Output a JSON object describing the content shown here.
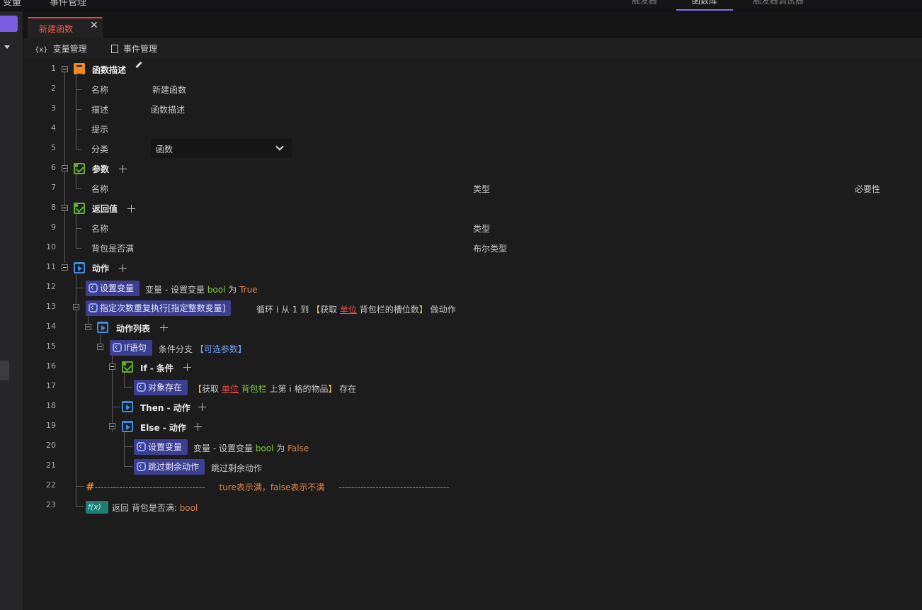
{
  "window": {
    "top_menu": {
      "variables": "变量",
      "events": "事件管理",
      "tabs": [
        "触发器",
        "函数库",
        "触发器调试器"
      ]
    }
  },
  "doc_tab": {
    "label": "新建函数",
    "close": "✕"
  },
  "toolbar": {
    "variables_label": "变量管理",
    "events_label": "事件管理",
    "variables_icon": "{x}"
  },
  "lines": [
    "1",
    "2",
    "3",
    "4",
    "5",
    "6",
    "7",
    "8",
    "9",
    "10",
    "11",
    "12",
    "13",
    "14",
    "15",
    "16",
    "17",
    "18",
    "19",
    "20",
    "21",
    "22",
    "23"
  ],
  "func_desc": {
    "title": "函数描述",
    "name_label": "名称",
    "name_value": "新建函数",
    "desc_label": "描述",
    "desc_value": "函数描述",
    "hint_label": "提示",
    "category_label": "分类",
    "category_value": "函数"
  },
  "params": {
    "title": "参数",
    "col_name": "名称",
    "col_type": "类型",
    "col_required": "必要性"
  },
  "returns": {
    "title": "返回值",
    "col_name": "名称",
    "col_type": "类型",
    "row_name": "背包是否满",
    "row_type": "布尔类型"
  },
  "actions": {
    "title": "动作",
    "set_var": {
      "badge": "设置变量",
      "t1": "变量 - 设置变量 ",
      "var": "bool",
      "t2": " 为 ",
      "val": "True"
    },
    "loop": {
      "badge": "指定次数重复执行[指定整数变量]",
      "t1": "循环 i 从 1 到 ",
      "b1": "【",
      "t2": "获取 ",
      "unit": "单位",
      "t3": " 背包栏的槽位数",
      "b2": "】",
      "t4": " 做动作"
    },
    "action_list": "动作列表",
    "if_stmt": {
      "badge": "If语句",
      "t1": "条件分支 ",
      "opt": "【可选参数】"
    },
    "if_cond": "If - 条件",
    "obj_exists": {
      "badge": "对象存在",
      "b1": "【",
      "t1": "获取 ",
      "unit": "单位",
      "bag": " 背包栏",
      "t2": " 上第 i 格的物品",
      "b2": "】",
      "t3": " 存在"
    },
    "then_action": "Then - 动作",
    "else_action": "Else - 动作",
    "set_var2": {
      "badge": "设置变量",
      "t1": "变量 - 设置变量 ",
      "var": "bool",
      "t2": " 为 ",
      "val": "False"
    },
    "skip": {
      "badge": "跳过剩余动作",
      "t1": "跳过剩余动作"
    },
    "comment": {
      "hash": "#",
      "dashes_left": "------------------------------------",
      "text": "ture表示满，false表示不满",
      "dashes_right": "------------------------------------"
    },
    "return": {
      "fx": "f(x)",
      "t1": "返回 背包是否满: ",
      "var": "bool"
    }
  }
}
